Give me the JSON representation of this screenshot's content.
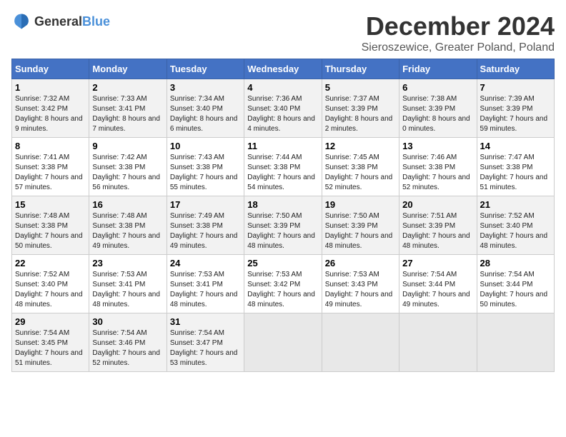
{
  "logo": {
    "general": "General",
    "blue": "Blue"
  },
  "title": "December 2024",
  "subtitle": "Sieroszewice, Greater Poland, Poland",
  "headers": [
    "Sunday",
    "Monday",
    "Tuesday",
    "Wednesday",
    "Thursday",
    "Friday",
    "Saturday"
  ],
  "weeks": [
    [
      {
        "day": "1",
        "sunrise": "Sunrise: 7:32 AM",
        "sunset": "Sunset: 3:42 PM",
        "daylight": "Daylight: 8 hours and 9 minutes."
      },
      {
        "day": "2",
        "sunrise": "Sunrise: 7:33 AM",
        "sunset": "Sunset: 3:41 PM",
        "daylight": "Daylight: 8 hours and 7 minutes."
      },
      {
        "day": "3",
        "sunrise": "Sunrise: 7:34 AM",
        "sunset": "Sunset: 3:40 PM",
        "daylight": "Daylight: 8 hours and 6 minutes."
      },
      {
        "day": "4",
        "sunrise": "Sunrise: 7:36 AM",
        "sunset": "Sunset: 3:40 PM",
        "daylight": "Daylight: 8 hours and 4 minutes."
      },
      {
        "day": "5",
        "sunrise": "Sunrise: 7:37 AM",
        "sunset": "Sunset: 3:39 PM",
        "daylight": "Daylight: 8 hours and 2 minutes."
      },
      {
        "day": "6",
        "sunrise": "Sunrise: 7:38 AM",
        "sunset": "Sunset: 3:39 PM",
        "daylight": "Daylight: 8 hours and 0 minutes."
      },
      {
        "day": "7",
        "sunrise": "Sunrise: 7:39 AM",
        "sunset": "Sunset: 3:39 PM",
        "daylight": "Daylight: 7 hours and 59 minutes."
      }
    ],
    [
      {
        "day": "8",
        "sunrise": "Sunrise: 7:41 AM",
        "sunset": "Sunset: 3:38 PM",
        "daylight": "Daylight: 7 hours and 57 minutes."
      },
      {
        "day": "9",
        "sunrise": "Sunrise: 7:42 AM",
        "sunset": "Sunset: 3:38 PM",
        "daylight": "Daylight: 7 hours and 56 minutes."
      },
      {
        "day": "10",
        "sunrise": "Sunrise: 7:43 AM",
        "sunset": "Sunset: 3:38 PM",
        "daylight": "Daylight: 7 hours and 55 minutes."
      },
      {
        "day": "11",
        "sunrise": "Sunrise: 7:44 AM",
        "sunset": "Sunset: 3:38 PM",
        "daylight": "Daylight: 7 hours and 54 minutes."
      },
      {
        "day": "12",
        "sunrise": "Sunrise: 7:45 AM",
        "sunset": "Sunset: 3:38 PM",
        "daylight": "Daylight: 7 hours and 52 minutes."
      },
      {
        "day": "13",
        "sunrise": "Sunrise: 7:46 AM",
        "sunset": "Sunset: 3:38 PM",
        "daylight": "Daylight: 7 hours and 52 minutes."
      },
      {
        "day": "14",
        "sunrise": "Sunrise: 7:47 AM",
        "sunset": "Sunset: 3:38 PM",
        "daylight": "Daylight: 7 hours and 51 minutes."
      }
    ],
    [
      {
        "day": "15",
        "sunrise": "Sunrise: 7:48 AM",
        "sunset": "Sunset: 3:38 PM",
        "daylight": "Daylight: 7 hours and 50 minutes."
      },
      {
        "day": "16",
        "sunrise": "Sunrise: 7:48 AM",
        "sunset": "Sunset: 3:38 PM",
        "daylight": "Daylight: 7 hours and 49 minutes."
      },
      {
        "day": "17",
        "sunrise": "Sunrise: 7:49 AM",
        "sunset": "Sunset: 3:38 PM",
        "daylight": "Daylight: 7 hours and 49 minutes."
      },
      {
        "day": "18",
        "sunrise": "Sunrise: 7:50 AM",
        "sunset": "Sunset: 3:39 PM",
        "daylight": "Daylight: 7 hours and 48 minutes."
      },
      {
        "day": "19",
        "sunrise": "Sunrise: 7:50 AM",
        "sunset": "Sunset: 3:39 PM",
        "daylight": "Daylight: 7 hours and 48 minutes."
      },
      {
        "day": "20",
        "sunrise": "Sunrise: 7:51 AM",
        "sunset": "Sunset: 3:39 PM",
        "daylight": "Daylight: 7 hours and 48 minutes."
      },
      {
        "day": "21",
        "sunrise": "Sunrise: 7:52 AM",
        "sunset": "Sunset: 3:40 PM",
        "daylight": "Daylight: 7 hours and 48 minutes."
      }
    ],
    [
      {
        "day": "22",
        "sunrise": "Sunrise: 7:52 AM",
        "sunset": "Sunset: 3:40 PM",
        "daylight": "Daylight: 7 hours and 48 minutes."
      },
      {
        "day": "23",
        "sunrise": "Sunrise: 7:53 AM",
        "sunset": "Sunset: 3:41 PM",
        "daylight": "Daylight: 7 hours and 48 minutes."
      },
      {
        "day": "24",
        "sunrise": "Sunrise: 7:53 AM",
        "sunset": "Sunset: 3:41 PM",
        "daylight": "Daylight: 7 hours and 48 minutes."
      },
      {
        "day": "25",
        "sunrise": "Sunrise: 7:53 AM",
        "sunset": "Sunset: 3:42 PM",
        "daylight": "Daylight: 7 hours and 48 minutes."
      },
      {
        "day": "26",
        "sunrise": "Sunrise: 7:53 AM",
        "sunset": "Sunset: 3:43 PM",
        "daylight": "Daylight: 7 hours and 49 minutes."
      },
      {
        "day": "27",
        "sunrise": "Sunrise: 7:54 AM",
        "sunset": "Sunset: 3:44 PM",
        "daylight": "Daylight: 7 hours and 49 minutes."
      },
      {
        "day": "28",
        "sunrise": "Sunrise: 7:54 AM",
        "sunset": "Sunset: 3:44 PM",
        "daylight": "Daylight: 7 hours and 50 minutes."
      }
    ],
    [
      {
        "day": "29",
        "sunrise": "Sunrise: 7:54 AM",
        "sunset": "Sunset: 3:45 PM",
        "daylight": "Daylight: 7 hours and 51 minutes."
      },
      {
        "day": "30",
        "sunrise": "Sunrise: 7:54 AM",
        "sunset": "Sunset: 3:46 PM",
        "daylight": "Daylight: 7 hours and 52 minutes."
      },
      {
        "day": "31",
        "sunrise": "Sunrise: 7:54 AM",
        "sunset": "Sunset: 3:47 PM",
        "daylight": "Daylight: 7 hours and 53 minutes."
      },
      null,
      null,
      null,
      null
    ]
  ]
}
